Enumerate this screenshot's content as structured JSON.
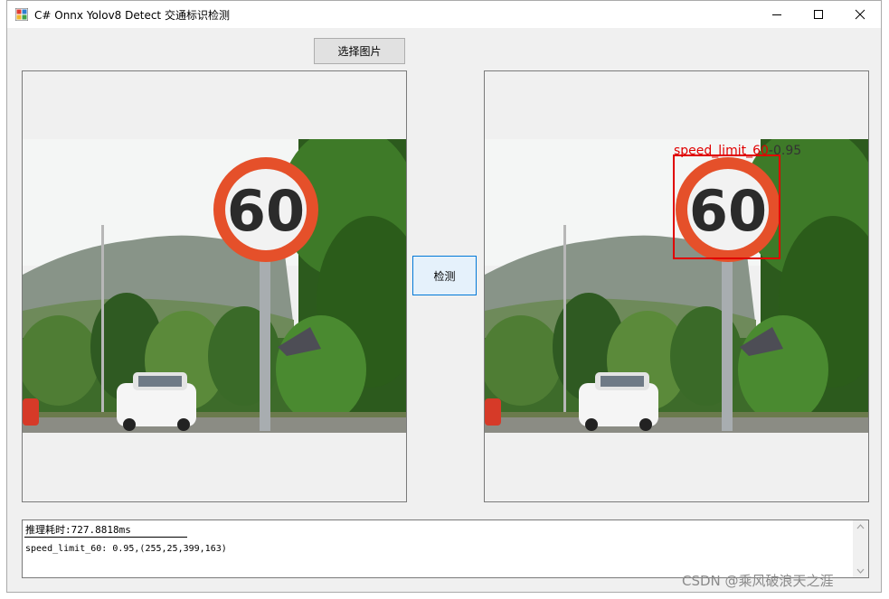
{
  "window": {
    "title": "C# Onnx Yolov8 Detect 交通标识检测"
  },
  "toolbar": {
    "select_image_label": "选择图片",
    "detect_label": "检测"
  },
  "detection": {
    "label": "speed_limit_60",
    "score": "0.95",
    "box_color": "#e00000"
  },
  "output": {
    "line1": "推理耗时:727.8818ms",
    "line2": "speed_limit_60: 0.95,(255,25,399,163)"
  },
  "watermark": "CSDN @乘风破浪天之涯"
}
